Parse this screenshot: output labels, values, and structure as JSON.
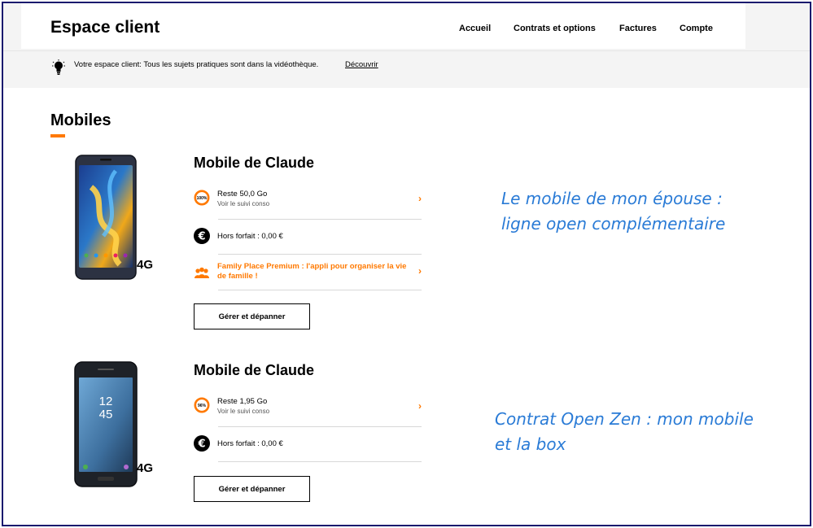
{
  "header": {
    "brand": "Espace client",
    "nav": [
      "Accueil",
      "Contrats et options",
      "Factures",
      "Compte"
    ]
  },
  "banner": {
    "icon": "lightbulb-icon",
    "text": "Votre espace client: Tous les sujets pratiques sont dans la vidéothèque.",
    "link": "Découvrir"
  },
  "section": {
    "title": "Mobiles"
  },
  "colors": {
    "accent": "#ff7900",
    "annotation": "#2a7bd6"
  },
  "mobiles": [
    {
      "title": "Mobile de Claude",
      "network": "4G",
      "data": {
        "gauge_label": "100%",
        "remaining": "Reste 50,0 Go",
        "link": "Voir le suivi conso"
      },
      "hors_forfait": "Hors forfait : 0,00 €",
      "promo": "Family Place Premium : l'appli pour organiser la vie de famille !",
      "button": "Gérer et dépanner"
    },
    {
      "title": "Mobile de Claude",
      "network": "4G",
      "data": {
        "gauge_label": "96%",
        "remaining": "Reste 1,95 Go",
        "link": "Voir le suivi conso"
      },
      "hors_forfait": "Hors forfait : 0,00 €",
      "button": "Gérer et dépanner"
    }
  ],
  "phone2_clock": {
    "hour": "12",
    "minute": "45"
  },
  "annotations": {
    "note1_line1": "Le mobile de mon épouse :",
    "note1_line2": "ligne open complémentaire",
    "note2_line1": "Contrat Open Zen : mon mobile",
    "note2_line2": "et la box"
  }
}
